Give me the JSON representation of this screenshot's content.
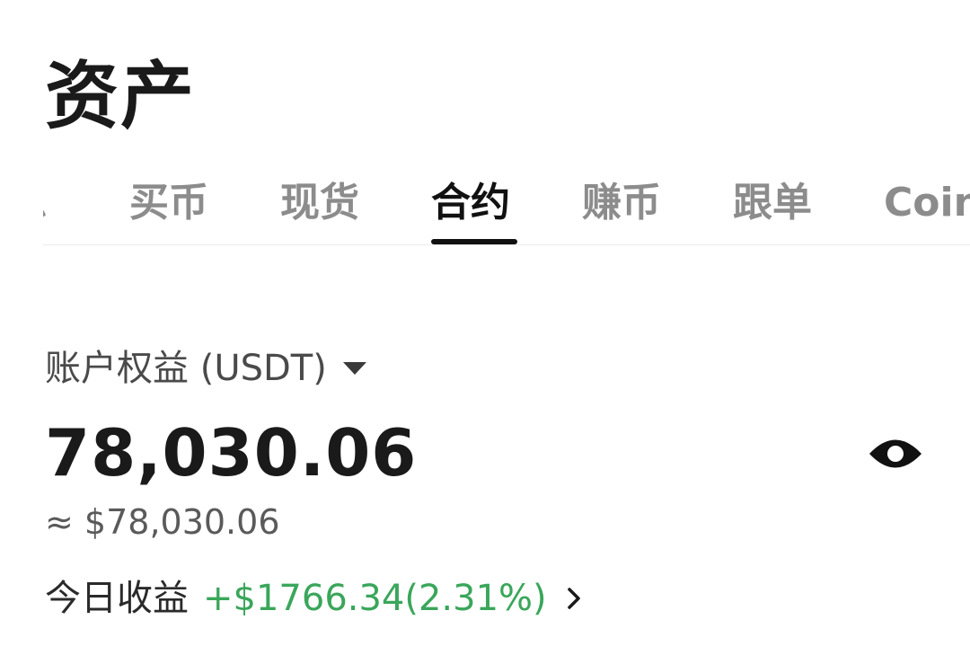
{
  "header": {
    "title": "资产"
  },
  "tabs": [
    {
      "label": "总",
      "active": false
    },
    {
      "label": "买币",
      "active": false
    },
    {
      "label": "现货",
      "active": false
    },
    {
      "label": "合约",
      "active": true
    },
    {
      "label": "赚币",
      "active": false
    },
    {
      "label": "跟单",
      "active": false
    },
    {
      "label": "Coin",
      "active": false
    }
  ],
  "account": {
    "equity_label": "账户权益 (USDT)",
    "balance": "78,030.06",
    "balance_fiat": "≈ $78,030.06",
    "today_pnl_label": "今日收益",
    "today_pnl_value": "+$1766.34(2.31%)"
  },
  "icons": {
    "dropdown": "caret-down-icon",
    "visibility": "eye-icon",
    "pnl_detail": "chevron-right-icon"
  },
  "colors": {
    "positive": "#3aa65a",
    "active_tab": "#111111",
    "inactive_tab": "#8c8c8c"
  }
}
